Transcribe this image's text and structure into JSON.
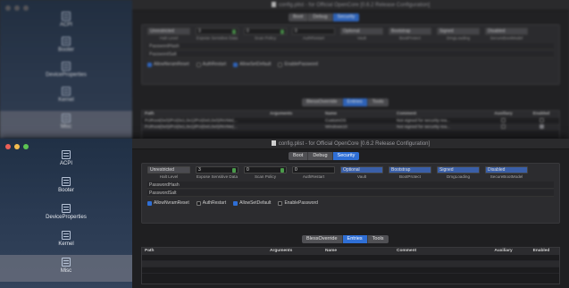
{
  "sidebar": {
    "items": [
      {
        "label": "ACPI"
      },
      {
        "label": "Booter"
      },
      {
        "label": "DeviceProperties"
      },
      {
        "label": "Kernel"
      },
      {
        "label": "Misc"
      }
    ],
    "selected": "Misc"
  },
  "window": {
    "title": "config.plist - for Official OpenCore [0.6.2 Release Configuration]"
  },
  "segments": {
    "top": [
      "Boot",
      "Debug",
      "Security"
    ],
    "top_selected": "Security",
    "bottom": [
      "BlessOverride",
      "Entries",
      "Tools"
    ],
    "bottom_selected": "Entries"
  },
  "security": {
    "options": [
      {
        "value": "Unrestricted",
        "label": "Halt Level"
      },
      {
        "value": "3",
        "label": "Expose Sensitive Data"
      },
      {
        "value": "0",
        "label": "Scan Policy"
      },
      {
        "value": "0",
        "label": "AuthRestart"
      },
      {
        "value": "Optional",
        "label": "Vault"
      },
      {
        "value": "Bootstrap",
        "label": "BootProtect"
      },
      {
        "value": "Signed",
        "label": "DmgLoading"
      },
      {
        "value": "Disabled",
        "label": "SecureBootModel"
      }
    ],
    "password_hash_label": "PasswordHash",
    "password_salt_label": "PasswordSalt",
    "checkboxes": [
      {
        "label": "AllowNvramReset",
        "checked": true
      },
      {
        "label": "AuthRestart",
        "checked": false
      },
      {
        "label": "AllowSetDefault",
        "checked": true
      },
      {
        "label": "EnablePassword",
        "checked": false
      }
    ]
  },
  "entries_table": {
    "columns": [
      "Path",
      "Arguments",
      "Name",
      "Comment",
      "Auxiliary",
      "Enabled"
    ],
    "rows": [
      {
        "path": "PciRoot(0x0)/Pci(0x1,0x1)/Pci(0x0,0x0)/NVMe(...",
        "arguments": "",
        "name": "CustomOS",
        "comment": "Not signed for security rea...",
        "auxiliary": false,
        "enabled": false
      },
      {
        "path": "PciRoot(0x0)/Pci(0x1,0x1)/Pci(0x0,0x0)/NVMe(...",
        "arguments": "",
        "name": "Windows10",
        "comment": "Not signed for security rea...",
        "auxiliary": false,
        "enabled": true
      }
    ]
  },
  "colors": {
    "accent": "#2f6fd6",
    "sidebar": "#2a3a52"
  }
}
